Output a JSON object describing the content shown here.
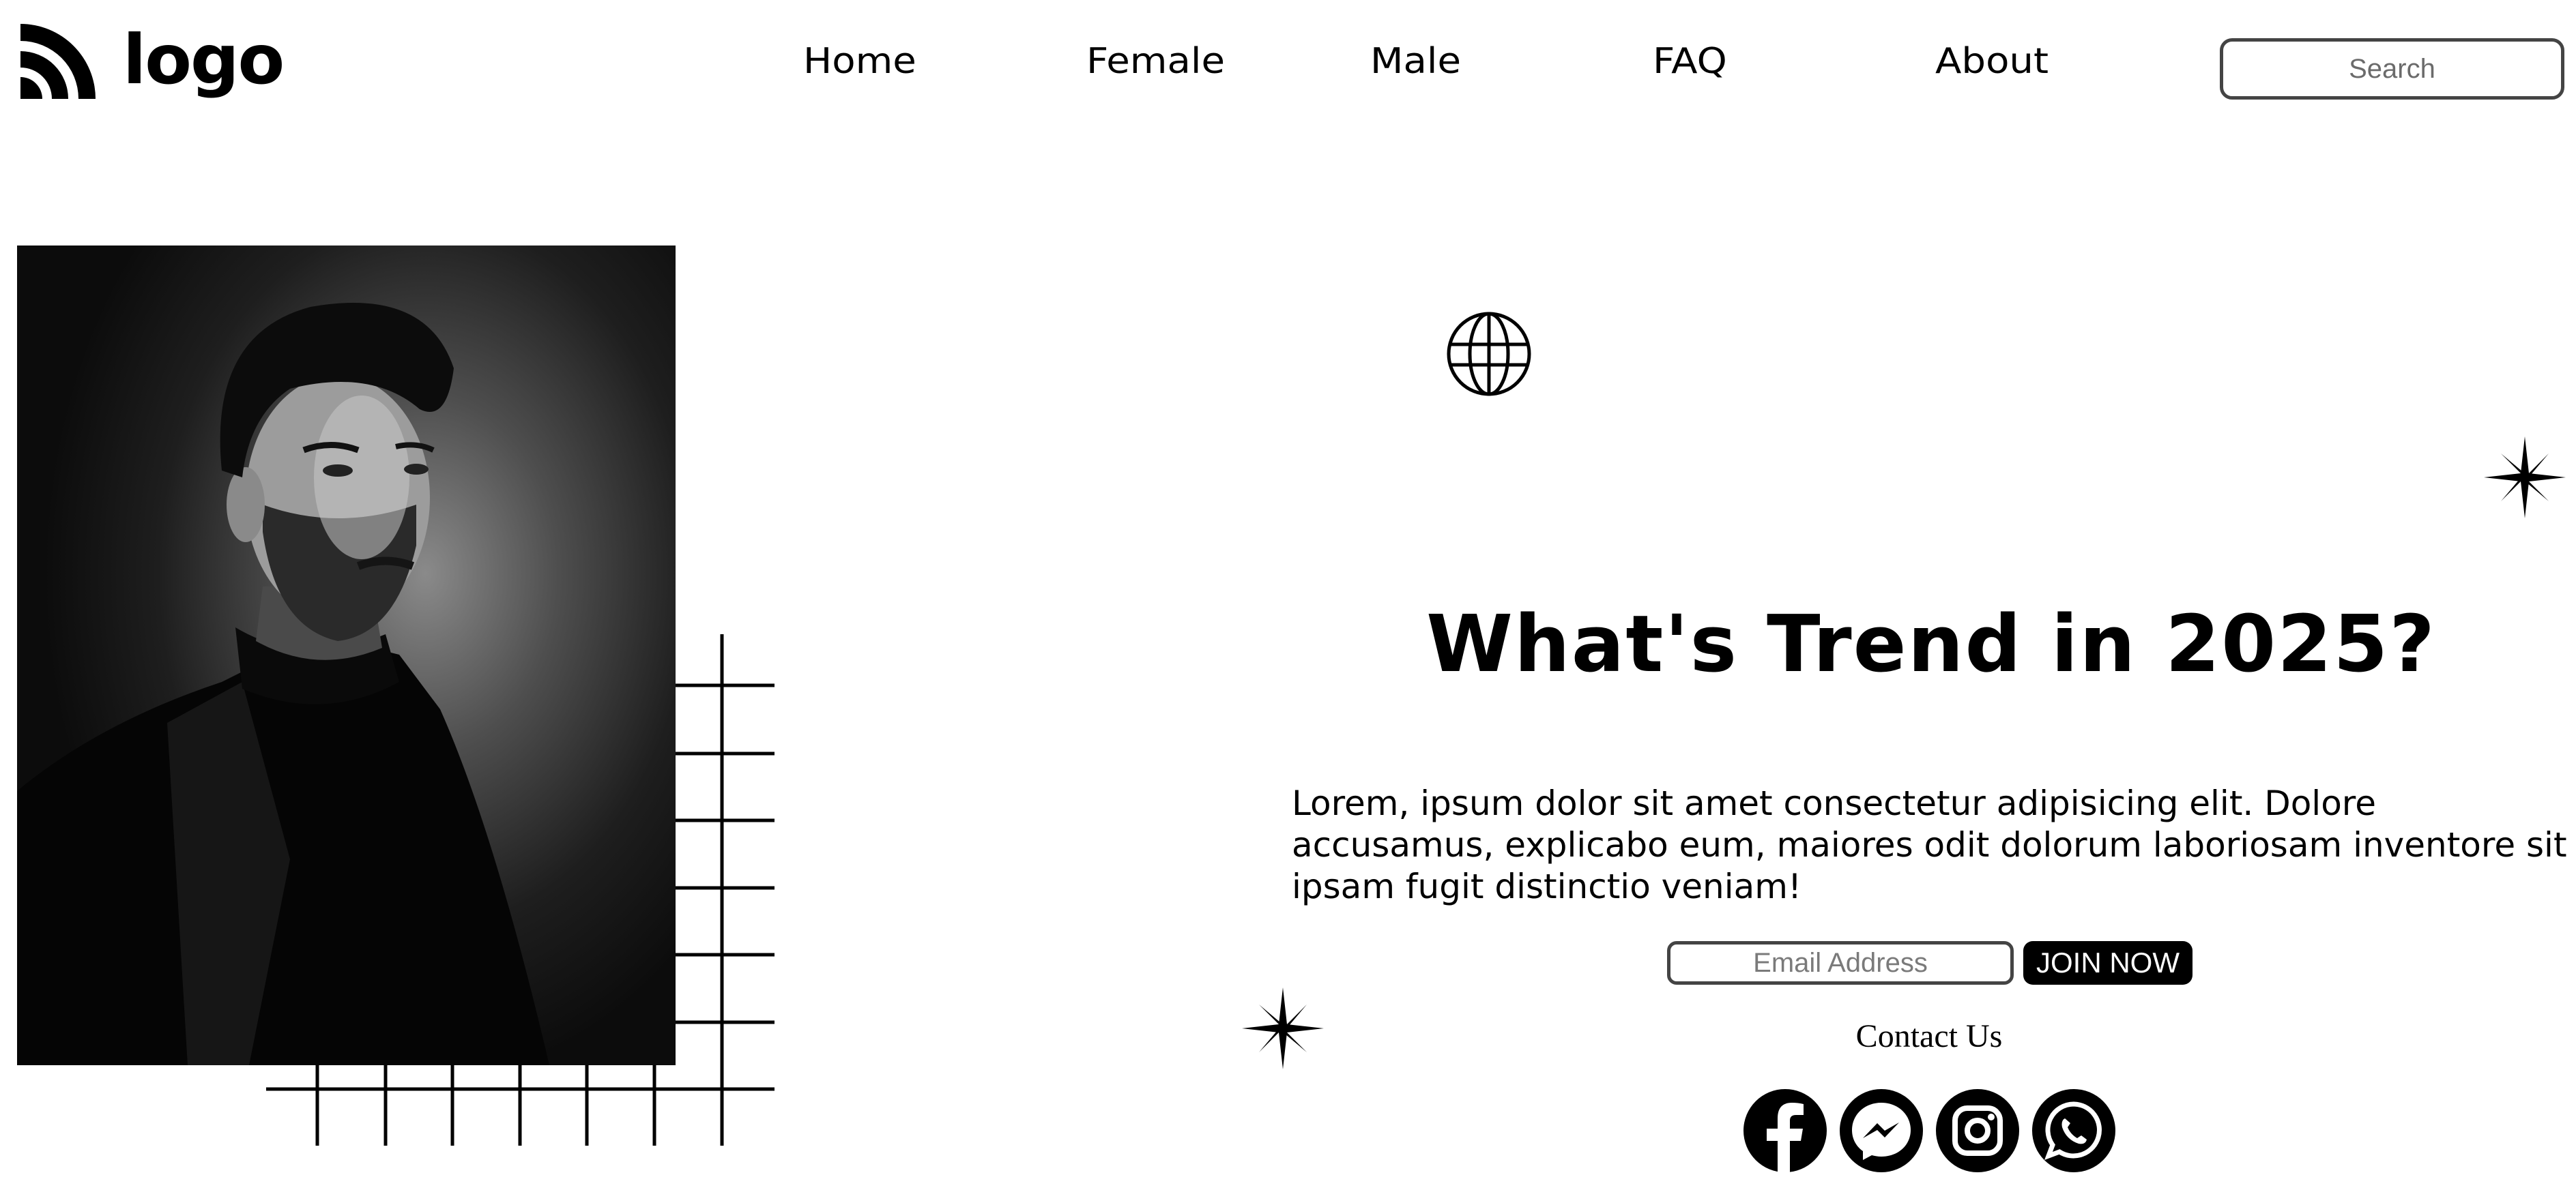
{
  "header": {
    "logo_text": "logo",
    "logo_icon": "wifi-signal-logo-icon",
    "nav": [
      {
        "label": "Home"
      },
      {
        "label": "Female"
      },
      {
        "label": "Male"
      },
      {
        "label": "FAQ"
      },
      {
        "label": "About"
      }
    ],
    "search": {
      "placeholder": "Search",
      "value": ""
    }
  },
  "hero": {
    "image": "black-and-white-portrait-man-in-black-turtleneck-and-blazer",
    "decorations": [
      "globe-icon",
      "sparkle-icon",
      "sparkle-icon",
      "grid-lines"
    ],
    "headline": "What's Trend in 2025?",
    "body": "Lorem, ipsum dolor sit amet consectetur adipisicing elit. Dolore accusamus, explicabo eum, maiores odit dolorum laboriosam inventore sit ipsam fugit distinctio veniam!",
    "email": {
      "placeholder": "Email Address",
      "value": ""
    },
    "join_label": "JOIN NOW",
    "contact_label": "Contact Us",
    "socials": [
      {
        "name": "facebook-icon"
      },
      {
        "name": "messenger-icon"
      },
      {
        "name": "instagram-icon"
      },
      {
        "name": "whatsapp-icon"
      }
    ]
  },
  "colors": {
    "background": "#ffffff",
    "text": "#000000",
    "button_bg": "#000000",
    "button_text": "#ffffff",
    "input_border": "#444444"
  }
}
